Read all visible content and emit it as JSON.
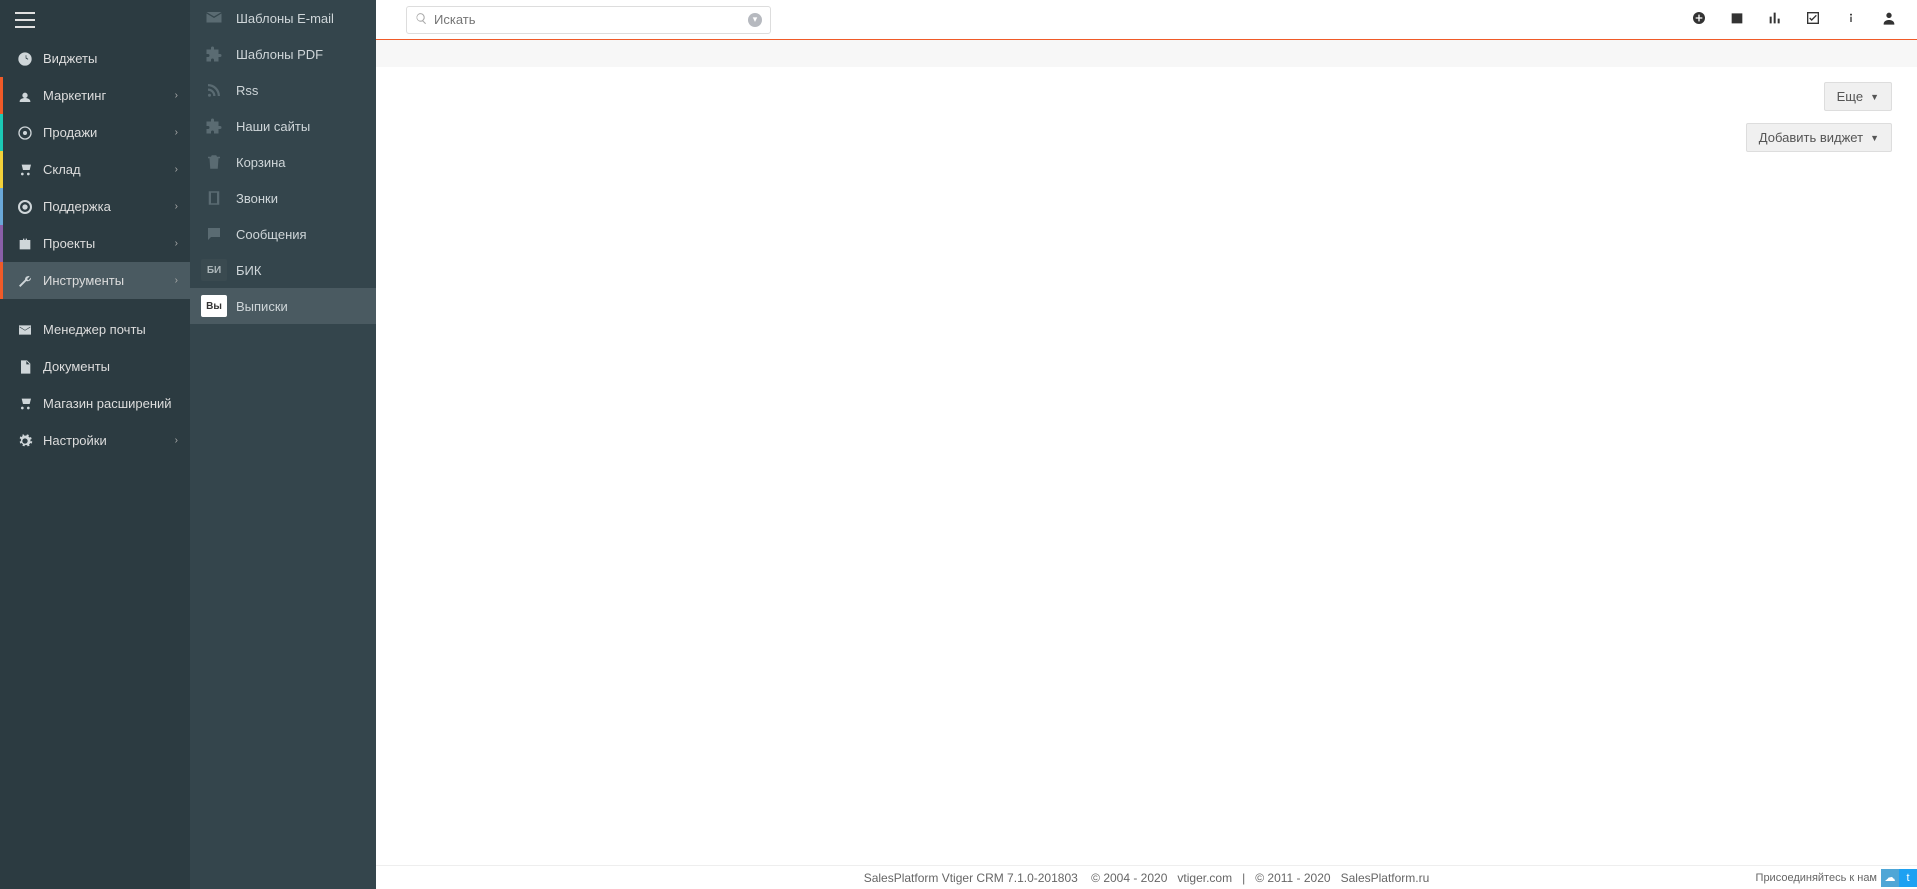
{
  "search": {
    "placeholder": "Искать"
  },
  "sidebar1": {
    "items": [
      {
        "label": "Виджеты"
      },
      {
        "label": "Маркетинг"
      },
      {
        "label": "Продажи"
      },
      {
        "label": "Склад"
      },
      {
        "label": "Поддержка"
      },
      {
        "label": "Проекты"
      },
      {
        "label": "Инструменты"
      },
      {
        "label": "Менеджер почты"
      },
      {
        "label": "Документы"
      },
      {
        "label": "Магазин расширений"
      },
      {
        "label": "Настройки"
      }
    ]
  },
  "sidebar2": {
    "items": [
      {
        "label": "Шаблоны E-mail"
      },
      {
        "label": "Шаблоны PDF"
      },
      {
        "label": "Rss"
      },
      {
        "label": "Наши сайты"
      },
      {
        "label": "Корзина"
      },
      {
        "label": "Звонки"
      },
      {
        "label": "Сообщения"
      },
      {
        "label": "БИК",
        "badge": "БИ"
      },
      {
        "label": "Выписки",
        "badge": "Вы"
      }
    ]
  },
  "toolbar": {
    "more_button": "Еще",
    "add_widget_button": "Добавить виджет"
  },
  "footer": {
    "product": "SalesPlatform Vtiger CRM 7.1.0-201803",
    "copyright1": "© 2004 - 2020",
    "link1": "vtiger.com",
    "sep": "|",
    "copyright2": "© 2011 - 2020",
    "link2": "SalesPlatform.ru",
    "join": "Присоединяйтесь к нам"
  }
}
